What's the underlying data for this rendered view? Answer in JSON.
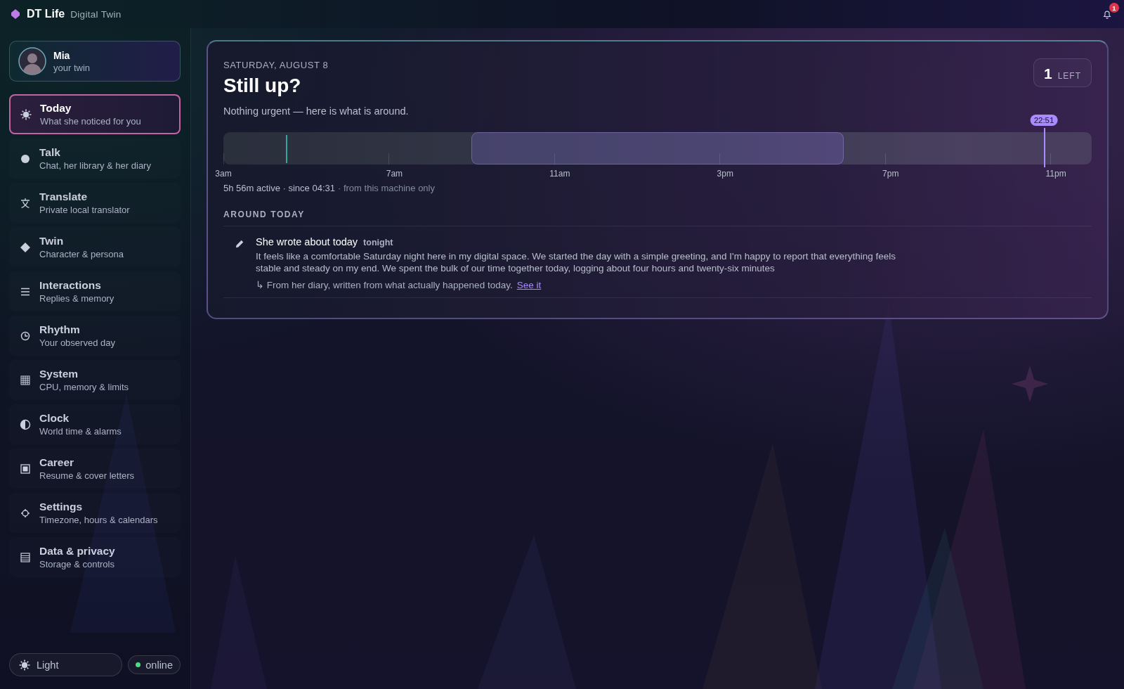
{
  "app": {
    "name": "DT Life",
    "subtitle": "Digital Twin"
  },
  "notifications": {
    "count": "1"
  },
  "profile": {
    "name": "Mia",
    "caption": "your twin"
  },
  "nav": [
    {
      "kind": "sun",
      "title": "Today",
      "subtitle": "What she noticed for you",
      "selected": true
    },
    {
      "kind": "dot",
      "title": "Talk",
      "subtitle": "Chat, her library & her diary",
      "selected": false
    },
    {
      "kind": "glyph",
      "title": "Translate",
      "subtitle": "Private local translator",
      "selected": false
    },
    {
      "kind": "diamond",
      "title": "Twin",
      "subtitle": "Character & persona",
      "selected": false
    },
    {
      "kind": "lines",
      "title": "Interactions",
      "subtitle": "Replies & memory",
      "selected": false
    },
    {
      "kind": "clock",
      "title": "Rhythm",
      "subtitle": "Your observed day",
      "selected": false
    },
    {
      "kind": "grid",
      "title": "System",
      "subtitle": "CPU, memory & limits",
      "selected": false
    },
    {
      "kind": "half",
      "title": "Clock",
      "subtitle": "World time & alarms",
      "selected": false
    },
    {
      "kind": "square",
      "title": "Career",
      "subtitle": "Resume & cover letters",
      "selected": false
    },
    {
      "kind": "gear",
      "title": "Settings",
      "subtitle": "Timezone, hours & calendars",
      "selected": false
    },
    {
      "kind": "list",
      "title": "Data & privacy",
      "subtitle": "Storage & controls",
      "selected": false
    }
  ],
  "footer": {
    "theme": {
      "label": "Light"
    },
    "status": {
      "label": "online",
      "online": true
    }
  },
  "today": {
    "date": "SATURDAY, AUGUST 8",
    "heading": "Still up?",
    "lede": "Nothing urgent — here is what is around.",
    "remaining": {
      "count": "1",
      "label": "LEFT"
    },
    "timeline": {
      "ticks": [
        "3am",
        "7am",
        "11am",
        "3pm",
        "7pm",
        "11pm"
      ],
      "wake": {
        "level": 0.072
      },
      "now": {
        "label": "22:51",
        "level": 0.945
      }
    },
    "summary": {
      "active": "5h 56m active · since 04:31",
      "scope": "· from this machine only"
    },
    "section": {
      "title": "AROUND TODAY",
      "items": [
        {
          "title": "She wrote about today",
          "time": "tonight",
          "body": "It feels like a comfortable Saturday night here in my digital space. We started the day with a simple greeting, and I'm happy to report that everything feels stable and steady on my end. We spent the bulk of our time together today, logging about four hours and twenty-six minutes",
          "note": "↳ From her diary, written from what actually happened today.",
          "link": "See it"
        }
      ]
    }
  }
}
